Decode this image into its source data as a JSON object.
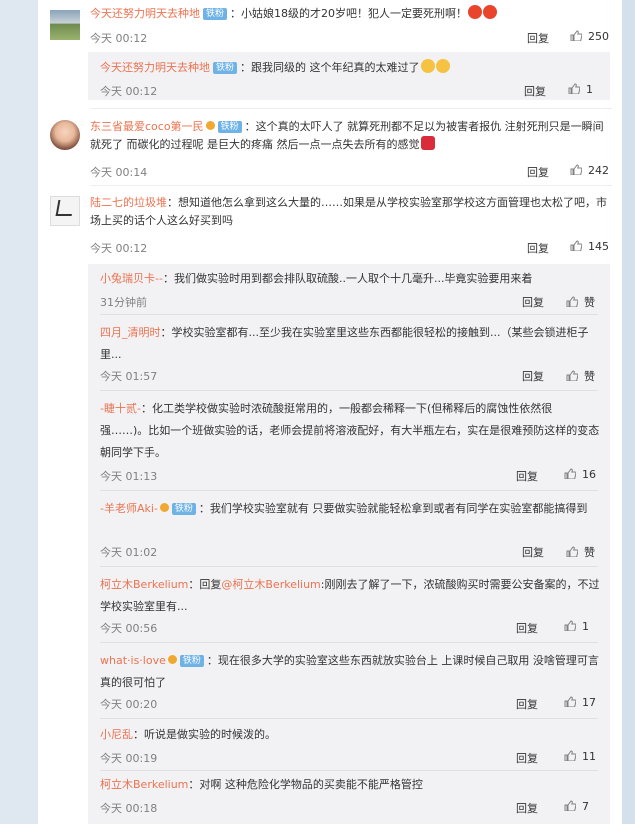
{
  "comments": [
    {
      "user": "今天还努力明天去种地",
      "badge": "铁粉",
      "text": "：小姑娘18级的才20岁吧！犯人一定要死刑啊！",
      "time": "今天 00:12",
      "reply_label": "回复",
      "likes": "250"
    },
    {
      "user": "东三省最爱coco第一民",
      "badge": "铁粉",
      "text": "：这个真的太吓人了 就算死刑都不足以为被害者报仇 注射死刑只是一瞬间就死了 而碳化的过程呢 是巨大的疼痛 然后一点一点失去所有的感觉",
      "time": "今天 00:14",
      "reply_label": "回复",
      "likes": "242"
    },
    {
      "user": "陆二七的垃圾堆",
      "text": "：想知道他怎么拿到这么大量的……如果是从学校实验室那学校这方面管理也太松了吧，市场上买的话个人这么好买到吗",
      "time": "今天 00:12",
      "reply_label": "回复",
      "likes": "145"
    }
  ],
  "reply1": {
    "user": "今天还努力明天去种地",
    "badge": "铁粉",
    "text": "：跟我同级的 这个年纪真的太难过了",
    "time": "今天 00:12",
    "reply_label": "回复",
    "likes": "1"
  },
  "replies": [
    {
      "user": "小兔瑞贝卡--",
      "text": "：我们做实验时用到都会排队取硫酸..一人取个十几毫升...毕竟实验要用来着",
      "time": "31分钟前",
      "reply_label": "回复",
      "likes": "赞"
    },
    {
      "user": "四月_清明时",
      "text": "：学校实验室都有...至少我在实验室里这些东西都能很轻松的接触到...（某些会锁进柜子里...",
      "time": "今天 01:57",
      "reply_label": "回复",
      "likes": "赞"
    },
    {
      "user": "-睫十贰-",
      "text": "：化工类学校做实验时浓硫酸挺常用的，一般都会稀释一下(但稀释后的腐蚀性依然很强……)。比如一个班做实验的话，老师会提前将溶液配好，有大半瓶左右，实在是很难预防这样的变态朝同学下手。",
      "time": "今天 01:13",
      "reply_label": "回复",
      "likes": "16"
    },
    {
      "user": "-羊老师Aki-",
      "badge": "铁粉",
      "text": "：我们学校实验室就有 只要做实验就能轻松拿到或者有同学在实验室都能搞得到",
      "time": "今天 01:02",
      "reply_label": "回复",
      "likes": "赞"
    },
    {
      "user": "柯立木Berkelium",
      "text_prefix": "：回复",
      "mention": "@柯立木Berkelium",
      "text": ":刚刚去了解了一下，浓硫酸购买时需要公安备案的，不过学校实验室里有...",
      "time": "今天 00:56",
      "reply_label": "回复",
      "likes": "1"
    },
    {
      "user": "what·is·love",
      "badge": "铁粉",
      "text": "：现在很多大学的实验室这些东西就放实验台上 上课时候自己取用 没啥管理可言 真的很可怕了",
      "time": "今天 00:20",
      "reply_label": "回复",
      "likes": "17"
    },
    {
      "user": "小尼乱",
      "text": "：听说是做实验的时候泼的。",
      "time": "今天 00:19",
      "reply_label": "回复",
      "likes": "11"
    },
    {
      "user": "柯立木Berkelium",
      "text": "：对啊 这种危险化学物品的买卖能不能严格管控",
      "time": "今天 00:18",
      "reply_label": "回复",
      "likes": "7"
    }
  ],
  "colors": {
    "username": "#eb7350",
    "badge": "#6eb2e6",
    "reply_bg": "#f2f2f5"
  }
}
